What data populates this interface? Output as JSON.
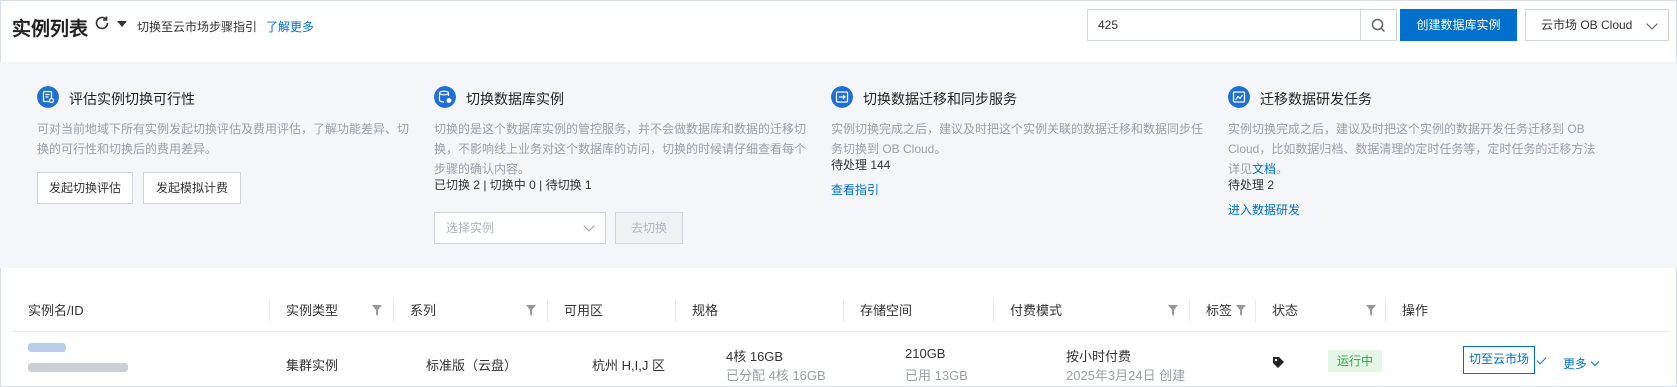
{
  "header": {
    "title": "实例列表",
    "guide_text": "切换至云市场步骤指引",
    "learn_more": "了解更多",
    "search_value": "425",
    "create_button": "创建数据库实例",
    "region_select": "云市场 OB Cloud"
  },
  "guide_cards": {
    "assess": {
      "title": "评估实例切换可行性",
      "desc": "可对当前地域下所有实例发起切换评估及费用评估，了解功能差异、切换的可行性和切换后的费用差异。",
      "btn1": "发起切换评估",
      "btn2": "发起模拟计费"
    },
    "switch": {
      "title": "切换数据库实例",
      "desc": "切换的是这个数据库实例的管控服务，并不会做数据库和数据的迁移切换，不影响线上业务对这个数据库的访问，切换的时候请仔细查看每个步骤的确认内容。",
      "stats": "已切换 2  |   切换中 0  |   待切换 1",
      "select_placeholder": "选择实例",
      "go_button": "去切换"
    },
    "migration": {
      "title": "切换数据迁移和同步服务",
      "desc": "实例切换完成之后，建议及时把这个实例关联的数据迁移和数据同步任务切换到 OB Cloud。",
      "pending": "待处理 144",
      "link": "查看指引"
    },
    "devtask": {
      "title": "迁移数据研发任务",
      "desc_prefix": "实例切换完成之后，建议及时把这个实例的数据开发任务迁移到 OB Cloud，比如数据归档、数据清理的定时任务等，定时任务的迁移方法详见",
      "desc_link": "文档",
      "desc_suffix": "。",
      "pending": "待处理 2",
      "link": "进入数据研发"
    }
  },
  "table": {
    "columns": [
      "实例名/ID",
      "实例类型",
      "系列",
      "可用区",
      "规格",
      "存储空间",
      "付费模式",
      "标签",
      "状态",
      "操作"
    ],
    "row": {
      "type": "集群实例",
      "series": "标准版（云盘）",
      "zone": "杭州 H,I,J 区",
      "spec": "4核 16GB",
      "spec_alloc": "已分配 4核 16GB",
      "storage": "210GB",
      "storage_used": "已用 13GB",
      "billing": "按小时付费",
      "created": "2025年3月24日 创建",
      "status": "运行中",
      "action_switch": "切至云市场",
      "action_more": "更多"
    }
  },
  "colors": {
    "accent": "#0070cc",
    "status_green": "#28a745",
    "panel_bg": "#f4f6f9"
  },
  "icons": [
    "refresh-icon",
    "search-icon",
    "assess-icon",
    "database-icon",
    "migration-icon",
    "devtask-icon",
    "tag-icon",
    "filter-icon"
  ]
}
